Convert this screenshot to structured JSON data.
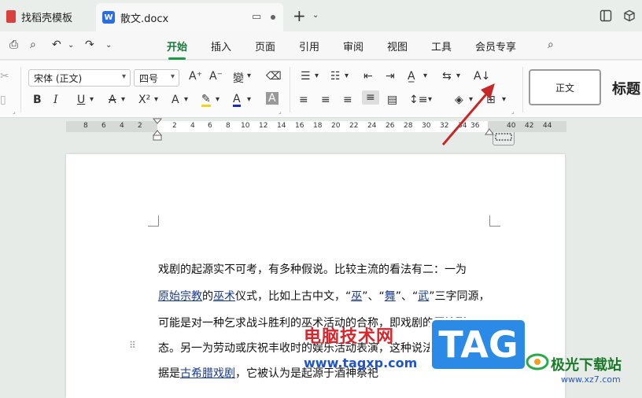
{
  "tabs": [
    {
      "label": "找稻壳模板"
    },
    {
      "label": "散文.docx"
    }
  ],
  "menu": {
    "items": [
      "开始",
      "插入",
      "页面",
      "引用",
      "审阅",
      "视图",
      "工具",
      "会员专享"
    ],
    "active": "开始"
  },
  "ribbon": {
    "font_name": "宋体 (正文)",
    "font_size": "四号",
    "style_normal": "正文",
    "style_heading": "标题"
  },
  "ruler": {
    "ticks": [
      "8",
      "6",
      "4",
      "2",
      "2",
      "4",
      "6",
      "8",
      "10",
      "12",
      "14",
      "16",
      "18",
      "20",
      "22",
      "24",
      "26",
      "28",
      "30",
      "32",
      "34",
      "36",
      "40",
      "42",
      "44"
    ]
  },
  "document": {
    "line1": "戏剧的起源实不可考，有多种假说。比较主流的看法有二：一为",
    "line2_a": "原始宗教",
    "line2_b": "的",
    "line2_c": "巫术",
    "line2_d": "仪式，比如上古中文，“",
    "line2_e": "巫",
    "line2_f": "”、“",
    "line2_g": "舞",
    "line2_h": "”、“",
    "line2_i": "武",
    "line2_j": "”三字同源，",
    "line3": "可能是对一种乞求战斗胜利的巫术活动的合称，即戏剧的原始形",
    "line4": "态。另一为劳动或庆祝丰收时的娱乐活动表演，这种说法主要依",
    "line5_a": "据是",
    "line5_b": "古希腊戏剧",
    "line5_c": "，它被认为是起源于酒神祭祀"
  },
  "watermark": {
    "site_name": "电脑技术网",
    "site_url": "www.tagxp.com",
    "tag_logo": "TAG",
    "brand2": "极光下载站",
    "brand2_url": "www.xz7.com"
  },
  "colors": {
    "accent_green": "#1a9a45",
    "arrow_red": "#c62828",
    "link_blue": "#1a3a8a"
  }
}
